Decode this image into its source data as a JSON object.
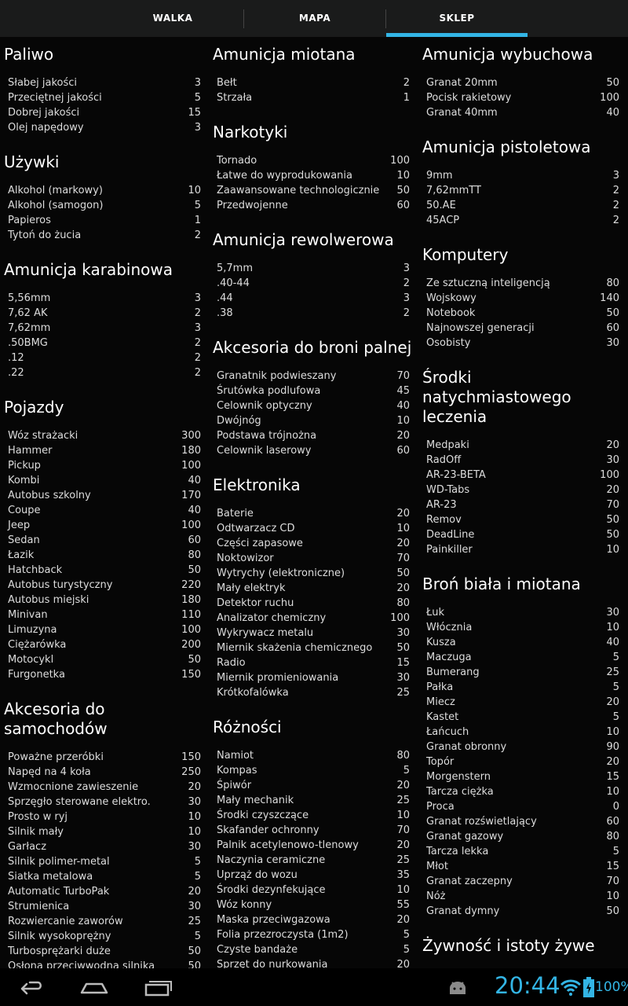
{
  "tabs": [
    {
      "label": "WALKA",
      "active": false
    },
    {
      "label": "MAPA",
      "active": false
    },
    {
      "label": "SKLEP",
      "active": true
    }
  ],
  "columns": [
    [
      {
        "title": "Paliwo",
        "items": [
          {
            "name": "Słabej jakości",
            "price": "3"
          },
          {
            "name": "Przeciętnej jakości",
            "price": "5"
          },
          {
            "name": "Dobrej jakości",
            "price": "15"
          },
          {
            "name": "Olej napędowy",
            "price": "3"
          }
        ]
      },
      {
        "title": "Używki",
        "items": [
          {
            "name": "Alkohol (markowy)",
            "price": "10"
          },
          {
            "name": "Alkohol (samogon)",
            "price": "5"
          },
          {
            "name": "Papieros",
            "price": "1"
          },
          {
            "name": "Tytoń do żucia",
            "price": "2"
          }
        ]
      },
      {
        "title": "Amunicja karabinowa",
        "items": [
          {
            "name": "5,56mm",
            "price": "3"
          },
          {
            "name": "7,62 AK",
            "price": "2"
          },
          {
            "name": "7,62mm",
            "price": "3"
          },
          {
            "name": ".50BMG",
            "price": "2"
          },
          {
            "name": ".12",
            "price": "2"
          },
          {
            "name": ".22",
            "price": "2"
          }
        ]
      },
      {
        "title": "Pojazdy",
        "items": [
          {
            "name": "Wóz strażacki",
            "price": "300"
          },
          {
            "name": "Hammer",
            "price": "180"
          },
          {
            "name": "Pickup",
            "price": "100"
          },
          {
            "name": "Kombi",
            "price": "40"
          },
          {
            "name": "Autobus szkolny",
            "price": "170"
          },
          {
            "name": "Coupe",
            "price": "40"
          },
          {
            "name": "Jeep",
            "price": "100"
          },
          {
            "name": "Sedan",
            "price": "60"
          },
          {
            "name": "Łazik",
            "price": "80"
          },
          {
            "name": "Hatchback",
            "price": "50"
          },
          {
            "name": "Autobus turystyczny",
            "price": "220"
          },
          {
            "name": "Autobus miejski",
            "price": "180"
          },
          {
            "name": "Minivan",
            "price": "110"
          },
          {
            "name": "Limuzyna",
            "price": "100"
          },
          {
            "name": "Ciężarówka",
            "price": "200"
          },
          {
            "name": "Motocykl",
            "price": "50"
          },
          {
            "name": "Furgonetka",
            "price": "150"
          }
        ]
      },
      {
        "title": "Akcesoria do samochodów",
        "items": [
          {
            "name": "Poważne przeróbki",
            "price": "150"
          },
          {
            "name": "Napęd na 4 koła",
            "price": "250"
          },
          {
            "name": "Wzmocnione zawieszenie",
            "price": "20"
          },
          {
            "name": "Sprzęgło sterowane elektro.",
            "price": "30"
          },
          {
            "name": "Prosto w ryj",
            "price": "10"
          },
          {
            "name": "Silnik mały",
            "price": "10"
          },
          {
            "name": "Garłacz",
            "price": "30"
          },
          {
            "name": "Silnik polimer-metal",
            "price": "5"
          },
          {
            "name": "Siatka metalowa",
            "price": "5"
          },
          {
            "name": "Automatic TurboPak",
            "price": "20"
          },
          {
            "name": "Strumienica",
            "price": "30"
          },
          {
            "name": "Rozwiercanie zaworów",
            "price": "25"
          },
          {
            "name": "Silnik wysokoprężny",
            "price": "5"
          },
          {
            "name": "Turbosprężarki duże",
            "price": "50"
          },
          {
            "name": "Osłona przeciwwodna silnika",
            "price": "50"
          }
        ]
      }
    ],
    [
      {
        "title": "Amunicja miotana",
        "items": [
          {
            "name": "Bełt",
            "price": "2"
          },
          {
            "name": "Strzała",
            "price": "1"
          }
        ]
      },
      {
        "title": "Narkotyki",
        "items": [
          {
            "name": "Tornado",
            "price": "100"
          },
          {
            "name": "Łatwe do wyprodukowania",
            "price": "10"
          },
          {
            "name": "Zaawansowane technologicznie",
            "price": "50"
          },
          {
            "name": "Przedwojenne",
            "price": "60"
          }
        ]
      },
      {
        "title": "Amunicja rewolwerowa",
        "items": [
          {
            "name": "5,7mm",
            "price": "3"
          },
          {
            "name": ".40-44",
            "price": "2"
          },
          {
            "name": ".44",
            "price": "3"
          },
          {
            "name": ".38",
            "price": "2"
          }
        ]
      },
      {
        "title": "Akcesoria do broni palnej",
        "items": [
          {
            "name": "Granatnik podwieszany",
            "price": "70"
          },
          {
            "name": "Śrutówka podlufowa",
            "price": "45"
          },
          {
            "name": "Celownik optyczny",
            "price": "40"
          },
          {
            "name": "Dwójnóg",
            "price": "10"
          },
          {
            "name": "Podstawa trójnożna",
            "price": "20"
          },
          {
            "name": "Celownik laserowy",
            "price": "60"
          }
        ]
      },
      {
        "title": "Elektronika",
        "items": [
          {
            "name": "Baterie",
            "price": "20"
          },
          {
            "name": "Odtwarzacz CD",
            "price": "10"
          },
          {
            "name": "Części zapasowe",
            "price": "20"
          },
          {
            "name": "Noktowizor",
            "price": "70"
          },
          {
            "name": "Wytrychy (elektroniczne)",
            "price": "50"
          },
          {
            "name": "Mały elektryk",
            "price": "20"
          },
          {
            "name": "Detektor ruchu",
            "price": "80"
          },
          {
            "name": "Analizator chemiczny",
            "price": "100"
          },
          {
            "name": "Wykrywacz metalu",
            "price": "30"
          },
          {
            "name": "Miernik skażenia chemicznego",
            "price": "50"
          },
          {
            "name": "Radio",
            "price": "15"
          },
          {
            "name": "Miernik promieniowania",
            "price": "30"
          },
          {
            "name": "Krótkofalówka",
            "price": "25"
          }
        ]
      },
      {
        "title": "Różności",
        "items": [
          {
            "name": "Namiot",
            "price": "80"
          },
          {
            "name": "Kompas",
            "price": "5"
          },
          {
            "name": "Śpiwór",
            "price": "20"
          },
          {
            "name": "Mały mechanik",
            "price": "25"
          },
          {
            "name": "Środki czyszczące",
            "price": "10"
          },
          {
            "name": "Skafander ochronny",
            "price": "70"
          },
          {
            "name": "Palnik acetylenowo-tlenowy",
            "price": "20"
          },
          {
            "name": "Naczynia ceramiczne",
            "price": "25"
          },
          {
            "name": "Uprząż do wozu",
            "price": "35"
          },
          {
            "name": "Środki dezynfekujące",
            "price": "10"
          },
          {
            "name": "Wóz konny",
            "price": "55"
          },
          {
            "name": "Maska przeciwgazowa",
            "price": "20"
          },
          {
            "name": "Folia przezroczysta (1m2)",
            "price": "5"
          },
          {
            "name": "Czyste bandaże",
            "price": "5"
          },
          {
            "name": "Sprzęt do nurkowania",
            "price": "20"
          }
        ]
      }
    ],
    [
      {
        "title": "Amunicja wybuchowa",
        "items": [
          {
            "name": "Granat 20mm",
            "price": "50"
          },
          {
            "name": "Pocisk rakietowy",
            "price": "100"
          },
          {
            "name": "Granat 40mm",
            "price": "40"
          }
        ]
      },
      {
        "title": "Amunicja pistoletowa",
        "items": [
          {
            "name": "9mm",
            "price": "3"
          },
          {
            "name": "7,62mmTT",
            "price": "2"
          },
          {
            "name": "50.AE",
            "price": "2"
          },
          {
            "name": "45ACP",
            "price": "2"
          }
        ]
      },
      {
        "title": "Komputery",
        "items": [
          {
            "name": "Ze sztuczną inteligencją",
            "price": "80"
          },
          {
            "name": "Wojskowy",
            "price": "140"
          },
          {
            "name": "Notebook",
            "price": "50"
          },
          {
            "name": "Najnowszej generacji",
            "price": "60"
          },
          {
            "name": "Osobisty",
            "price": "30"
          }
        ]
      },
      {
        "title": "Środki natychmiastowego leczenia",
        "items": [
          {
            "name": "Medpaki",
            "price": "20"
          },
          {
            "name": "RadOff",
            "price": "30"
          },
          {
            "name": "AR-23-BETA",
            "price": "100"
          },
          {
            "name": "WD-Tabs",
            "price": "20"
          },
          {
            "name": "AR-23",
            "price": "70"
          },
          {
            "name": "Remov",
            "price": "50"
          },
          {
            "name": "DeadLine",
            "price": "50"
          },
          {
            "name": "Painkiller",
            "price": "10"
          }
        ]
      },
      {
        "title": "Broń biała i miotana",
        "items": [
          {
            "name": "Łuk",
            "price": "30"
          },
          {
            "name": "Włócznia",
            "price": "10"
          },
          {
            "name": "Kusza",
            "price": "40"
          },
          {
            "name": "Maczuga",
            "price": "5"
          },
          {
            "name": "Bumerang",
            "price": "25"
          },
          {
            "name": "Pałka",
            "price": "5"
          },
          {
            "name": "Miecz",
            "price": "20"
          },
          {
            "name": "Kastet",
            "price": "5"
          },
          {
            "name": "Łańcuch",
            "price": "10"
          },
          {
            "name": "Granat obronny",
            "price": "90"
          },
          {
            "name": "Topór",
            "price": "20"
          },
          {
            "name": "Morgenstern",
            "price": "15"
          },
          {
            "name": "Tarcza ciężka",
            "price": "10"
          },
          {
            "name": "Proca",
            "price": "0"
          },
          {
            "name": "Granat rozświetlający",
            "price": "60"
          },
          {
            "name": "Granat gazowy",
            "price": "80"
          },
          {
            "name": "Tarcza lekka",
            "price": "5"
          },
          {
            "name": "Młot",
            "price": "15"
          },
          {
            "name": "Granat zaczepny",
            "price": "70"
          },
          {
            "name": "Nóż",
            "price": "10"
          },
          {
            "name": "Granat dymny",
            "price": "50"
          }
        ]
      },
      {
        "title": "Żywność i istoty żywe",
        "items": []
      }
    ]
  ],
  "system_bar": {
    "clock": "20:44",
    "battery_pct": "100%",
    "accent_color": "#33b5e5",
    "icons": [
      "back-icon",
      "home-icon",
      "recent-apps-icon",
      "android-icon",
      "wifi-icon",
      "battery-charging-icon"
    ]
  }
}
